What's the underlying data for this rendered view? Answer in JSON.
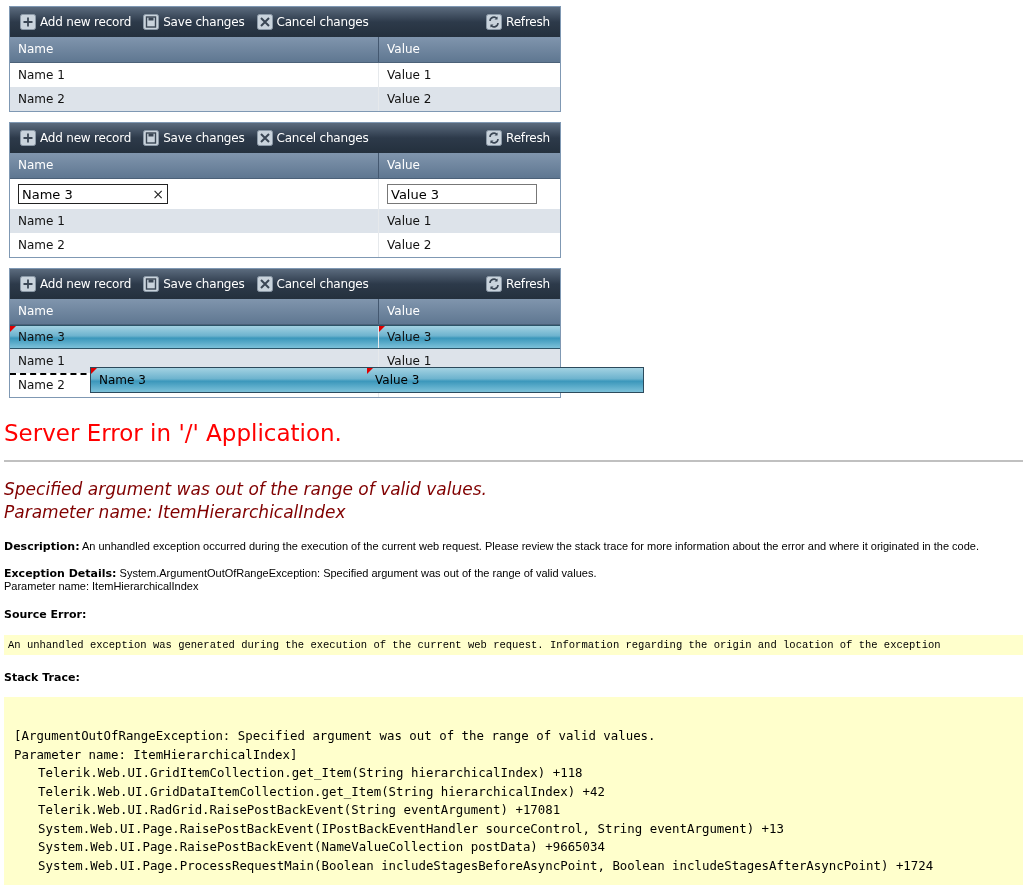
{
  "grids": [
    {
      "toolbar": {
        "buttons": [
          {
            "kind": "add",
            "label": "Add new record"
          },
          {
            "kind": "save",
            "label": "Save changes"
          },
          {
            "kind": "cancel",
            "label": "Cancel changes"
          }
        ],
        "refresh": {
          "kind": "refresh",
          "label": "Refresh"
        }
      },
      "columns": [
        "Name",
        "Value"
      ],
      "rows": [
        {
          "kind": "data",
          "cells": [
            "Name 1",
            "Value 1"
          ],
          "selected": false,
          "edited": false,
          "drop_target": false
        },
        {
          "kind": "data",
          "cells": [
            "Name 2",
            "Value 2"
          ],
          "selected": false,
          "edited": false,
          "drop_target": false
        }
      ]
    },
    {
      "toolbar": {
        "buttons": [
          {
            "kind": "add",
            "label": "Add new record"
          },
          {
            "kind": "save",
            "label": "Save changes"
          },
          {
            "kind": "cancel",
            "label": "Cancel changes"
          }
        ],
        "refresh": {
          "kind": "refresh",
          "label": "Refresh"
        }
      },
      "columns": [
        "Name",
        "Value"
      ],
      "rows": [
        {
          "kind": "edit",
          "cells": [
            "Name 3",
            "Value 3"
          ],
          "clear_glyph": "×"
        },
        {
          "kind": "data",
          "cells": [
            "Name 1",
            "Value 1"
          ],
          "selected": false,
          "edited": false,
          "drop_target": false
        },
        {
          "kind": "data",
          "cells": [
            "Name 2",
            "Value 2"
          ],
          "selected": false,
          "edited": false,
          "drop_target": false
        }
      ]
    },
    {
      "toolbar": {
        "buttons": [
          {
            "kind": "add",
            "label": "Add new record"
          },
          {
            "kind": "save",
            "label": "Save changes"
          },
          {
            "kind": "cancel",
            "label": "Cancel changes"
          }
        ],
        "refresh": {
          "kind": "refresh",
          "label": "Refresh"
        }
      },
      "columns": [
        "Name",
        "Value"
      ],
      "rows": [
        {
          "kind": "data",
          "cells": [
            "Name 3",
            "Value 3"
          ],
          "selected": true,
          "edited": true,
          "drop_target": false
        },
        {
          "kind": "data",
          "cells": [
            "Name 1",
            "Value 1"
          ],
          "selected": false,
          "edited": false,
          "drop_target": false
        },
        {
          "kind": "data",
          "cells": [
            "Name 2"
          ],
          "selected": false,
          "edited": false,
          "drop_target": true
        }
      ],
      "drag_row": {
        "cells": [
          "Name 3",
          "Value 3"
        ],
        "edited": true
      }
    }
  ],
  "error": {
    "title": "Server Error in '/' Application.",
    "message": [
      "Specified argument was out of the range of valid values.",
      "Parameter name: ItemHierarchicalIndex"
    ],
    "description": "**Description:** An unhandled exception occurred during the execution of the current web request. Please review the stack trace for more information about the error and where it originated in the code.",
    "exception_details": [
      "**Exception Details:** System.ArgumentOutOfRangeException: Specified argument was out of the range of valid values.",
      "Parameter name: ItemHierarchicalIndex"
    ],
    "source_error_heading": "Source Error:",
    "source_error": "An unhandled exception was generated during the execution of the current web request. Information regarding the origin and location of the exception",
    "stack_trace_heading": "Stack Trace:",
    "stack_trace": [
      {
        "kind": "message",
        "text": "[ArgumentOutOfRangeException: Specified argument was out of the range of valid values."
      },
      {
        "kind": "message",
        "text": "Parameter name: ItemHierarchicalIndex]"
      },
      {
        "kind": "frame",
        "text": "Telerik.Web.UI.GridItemCollection.get_Item(String hierarchicalIndex) +118"
      },
      {
        "kind": "frame",
        "text": "Telerik.Web.UI.GridDataItemCollection.get_Item(String hierarchicalIndex) +42"
      },
      {
        "kind": "frame",
        "text": "Telerik.Web.UI.RadGrid.RaisePostBackEvent(String eventArgument) +17081"
      },
      {
        "kind": "frame",
        "text": "System.Web.UI.Page.RaisePostBackEvent(IPostBackEventHandler sourceControl, String eventArgument) +13"
      },
      {
        "kind": "frame",
        "text": "System.Web.UI.Page.RaisePostBackEvent(NameValueCollection postData) +9665034"
      },
      {
        "kind": "frame",
        "text": "System.Web.UI.Page.ProcessRequestMain(Boolean includeStagesBeforeAsyncPoint, Boolean includeStagesAfterAsyncPoint) +1724"
      }
    ]
  }
}
